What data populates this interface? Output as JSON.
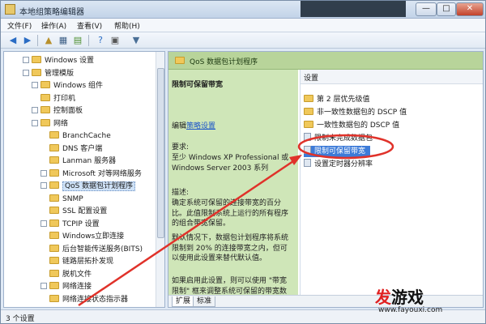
{
  "window": {
    "title": "本地组策略编辑器",
    "min": "—",
    "max": "□",
    "close": "✕"
  },
  "menu": [
    "文件(F)",
    "操作(A)",
    "查看(V)",
    "帮助(H)"
  ],
  "tree": [
    {
      "label": "Windows 设置",
      "indent": 1,
      "expander": true
    },
    {
      "label": "管理模版",
      "indent": 1,
      "expander": true
    },
    {
      "label": "Windows 组件",
      "indent": 2,
      "expander": true
    },
    {
      "label": "打印机",
      "indent": 2,
      "expander": false
    },
    {
      "label": "控制面板",
      "indent": 2,
      "expander": true
    },
    {
      "label": "网络",
      "indent": 2,
      "expander": true
    },
    {
      "label": "BranchCache",
      "indent": 3,
      "expander": false
    },
    {
      "label": "DNS 客户端",
      "indent": 3,
      "expander": false
    },
    {
      "label": "Lanman 服务器",
      "indent": 3,
      "expander": false
    },
    {
      "label": "Microsoft 对等网络服务",
      "indent": 3,
      "expander": true
    },
    {
      "label": "QoS 数据包计划程序",
      "indent": 3,
      "expander": true,
      "selected": true
    },
    {
      "label": "SNMP",
      "indent": 3,
      "expander": false
    },
    {
      "label": "SSL 配置设置",
      "indent": 3,
      "expander": false
    },
    {
      "label": "TCPIP 设置",
      "indent": 3,
      "expander": true
    },
    {
      "label": "Windows立即连接",
      "indent": 3,
      "expander": false
    },
    {
      "label": "后台智能传送服务(BITS)",
      "indent": 3,
      "expander": false
    },
    {
      "label": "链路层拓扑发现",
      "indent": 3,
      "expander": false
    },
    {
      "label": "脱机文件",
      "indent": 3,
      "expander": false
    },
    {
      "label": "网络连接",
      "indent": 3,
      "expander": true
    },
    {
      "label": "网络连接状态指示器",
      "indent": 3,
      "expander": false
    }
  ],
  "right": {
    "header": "QoS 数据包计划程序",
    "desc_title": "限制可保留带宽",
    "edit_prefix": "编辑",
    "edit_link": "策略设置",
    "requirements_label": "要求:",
    "requirements_text": "至少 Windows XP Professional 或 Windows Server 2003 系列",
    "description_label": "描述:",
    "description_text": "确定系统可保留的连接带宽的百分比。此值限制系统上运行的所有程序的组合带宽保留。",
    "default_text": "默认情况下，数据包计划程序将系统限制到 20% 的连接带宽之内，但可以使用此设置来替代默认值。",
    "enabled_text": "如果启用此设置，则可以使用 \"带宽限制\" 框来调整系统可保留的带宽数量。",
    "list_header": "设置",
    "items": [
      {
        "label": "第 2 层优先级值",
        "type": "folder"
      },
      {
        "label": "非一致性数据包的 DSCP 值",
        "type": "folder"
      },
      {
        "label": "一致性数据包的 DSCP 值",
        "type": "folder"
      },
      {
        "label": "限制未完成数据包",
        "type": "setting"
      },
      {
        "label": "限制可保留带宽",
        "type": "setting",
        "highlight": true
      },
      {
        "label": "设置定时器分辨率",
        "type": "setting"
      }
    ],
    "tabs": [
      "扩展",
      "标准"
    ]
  },
  "status": "3 个设置",
  "watermark": {
    "logo_a": "发",
    "logo_b": "游戏",
    "url": "www.fayouxi.com"
  },
  "colors": {
    "annotation_red": "#e0322a",
    "header_green": "#b8d49a",
    "desc_green": "#cfe6b8",
    "highlight_blue": "#3d7bd8"
  }
}
